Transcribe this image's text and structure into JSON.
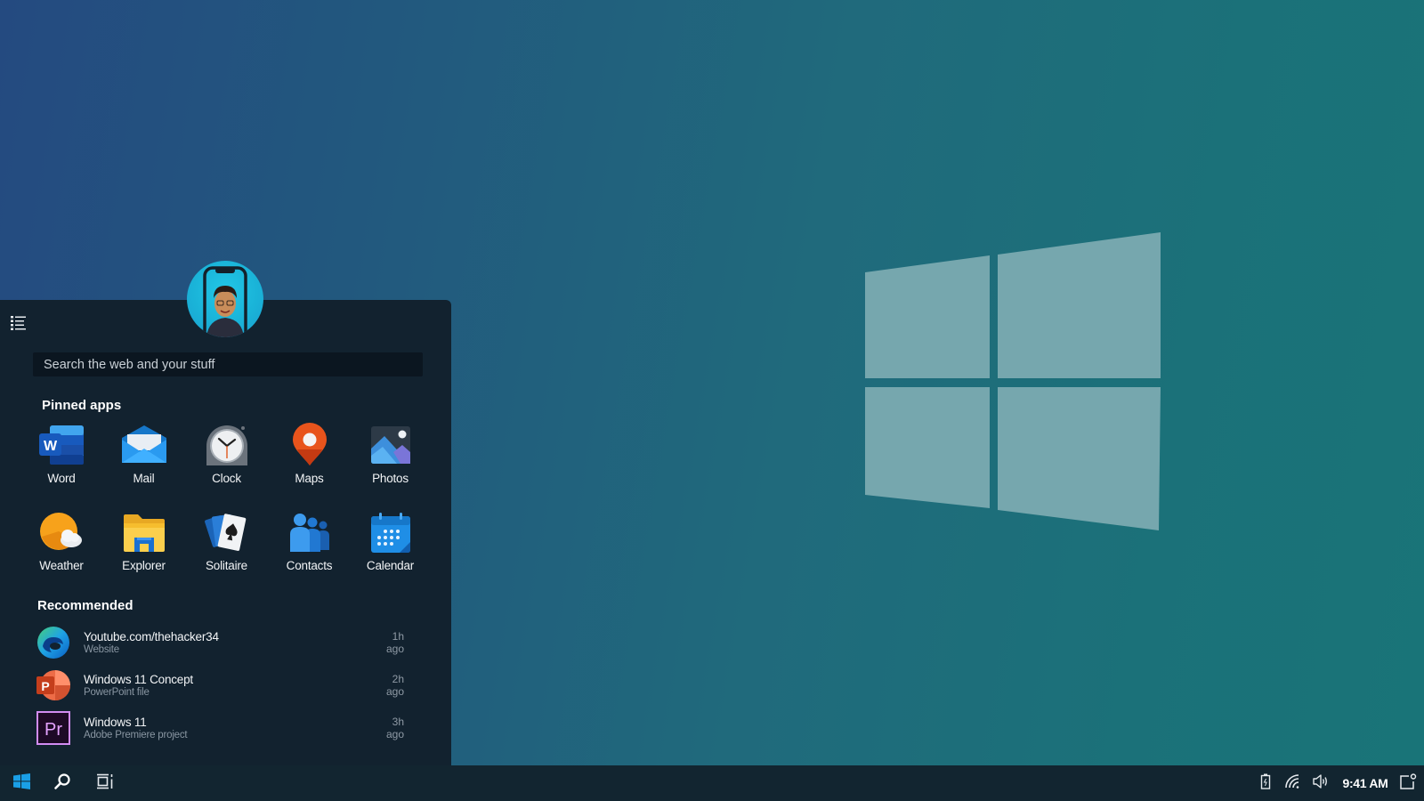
{
  "colors": {
    "panel_bg": "#12222f",
    "taskbar_bg": "#122530",
    "accent": "#1a9fe0",
    "wallpaper_logo": "#76a7ae"
  },
  "start_menu": {
    "menu_icon": "list-icon",
    "avatar": "user-avatar",
    "search": {
      "placeholder": "Search the web and your stuff",
      "value": ""
    },
    "pinned": {
      "title": "Pinned apps",
      "apps": [
        {
          "label": "Word",
          "icon": "word-icon"
        },
        {
          "label": "Mail",
          "icon": "mail-icon"
        },
        {
          "label": "Clock",
          "icon": "clock-icon"
        },
        {
          "label": "Maps",
          "icon": "maps-icon"
        },
        {
          "label": "Photos",
          "icon": "photos-icon"
        },
        {
          "label": "Weather",
          "icon": "weather-icon"
        },
        {
          "label": "Explorer",
          "icon": "folder-icon"
        },
        {
          "label": "Solitaire",
          "icon": "cards-icon"
        },
        {
          "label": "Contacts",
          "icon": "contacts-icon"
        },
        {
          "label": "Calendar",
          "icon": "calendar-icon"
        }
      ]
    },
    "recommended": {
      "title": "Recommended",
      "items": [
        {
          "name": "Youtube.com/thehacker34",
          "type": "Website",
          "time": "1h ago",
          "icon": "edge-icon"
        },
        {
          "name": "Windows 11 Concept",
          "type": "PowerPoint file",
          "time": "2h ago",
          "icon": "powerpoint-icon"
        },
        {
          "name": "Windows 11",
          "type": "Adobe Premiere project",
          "time": "3h ago",
          "icon": "premiere-icon"
        }
      ]
    }
  },
  "taskbar": {
    "start_icon": "windows-logo-icon",
    "search_icon": "search-icon",
    "task_view_icon": "task-view-icon",
    "tray": {
      "battery_icon": "battery-icon",
      "wifi_icon": "wifi-icon",
      "volume_icon": "volume-icon",
      "time": "9:41 AM",
      "notifications_icon": "notification-icon"
    }
  }
}
